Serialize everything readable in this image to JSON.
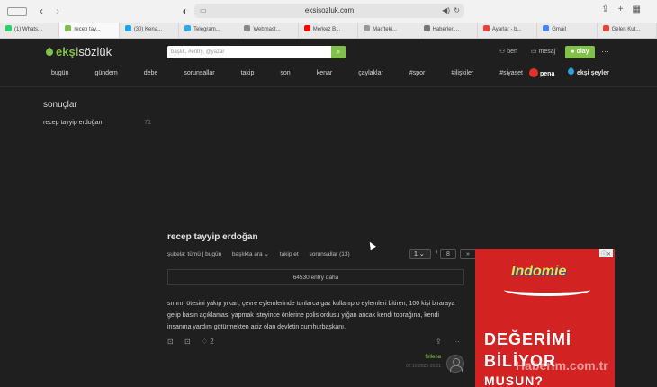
{
  "browser": {
    "url": "eksisozluk.com",
    "tabs": [
      {
        "label": "(1) Whats...",
        "color": "#25d366"
      },
      {
        "label": "recep tay...",
        "color": "#81c14b"
      },
      {
        "label": "(30) Kena...",
        "color": "#1da1f2"
      },
      {
        "label": "Telegram...",
        "color": "#2aabee"
      },
      {
        "label": "Webmast...",
        "color": "#888888"
      },
      {
        "label": "Merkez B...",
        "color": "#ff0000"
      },
      {
        "label": "Mac'teki...",
        "color": "#999999"
      },
      {
        "label": "Haberler,...",
        "color": "#777777"
      },
      {
        "label": "Ayarlar - b...",
        "color": "#ea4335"
      },
      {
        "label": "Gmail",
        "color": "#4285f4"
      },
      {
        "label": "Gelen Kut...",
        "color": "#ea4335"
      }
    ]
  },
  "header": {
    "logo_part1": "ekşi",
    "logo_part2": "sözlük",
    "search_placeholder": "başlık, #entry, @yazar",
    "user_label": "ben",
    "message_label": "mesaj",
    "event_label": "olay",
    "nav": [
      "bugün",
      "gündem",
      "debe",
      "sorunsallar",
      "takip",
      "son",
      "kenar",
      "çaylaklar",
      "#spor",
      "#ilişkiler",
      "#siyaset",
      "..."
    ],
    "pena_label": "pena",
    "eksiseyler_label": "ekşi şeyler"
  },
  "sidebar": {
    "title": "sonuçlar",
    "item_label": "recep tayyip erdoğan",
    "item_count": "71"
  },
  "topic": {
    "title": "recep tayyip erdoğan",
    "filters": [
      "şukela:  tümü | bugün",
      "başlıkta ara ⌄",
      "takip et",
      "sorunsallar (13)"
    ],
    "current_page": "1",
    "total_pages": "8",
    "next_label": "»",
    "more_entries": "64530 entry daha",
    "entry_text": "sınırın ötesini yakıp yıkan, çevre eylemlerinde tonlarca gaz kullanıp o eylemleri bitiren, 100 kişi biraraya gelip basın açıklaması yapmak isteyince önlerine polis ordusu yığan ancak kendi toprağına, kendi insanına yardım götürmekten aciz olan devletin cumhurbaşkanı.",
    "fav_count": "2",
    "author": "fellena",
    "date": "07.10.2023 09:21"
  },
  "ad": {
    "brand": "Indomie",
    "line1": "DEĞERİMİ",
    "line2": "BİLİYOR",
    "line3": "MUSUN?"
  },
  "watermark": "Haberim.com.tr"
}
